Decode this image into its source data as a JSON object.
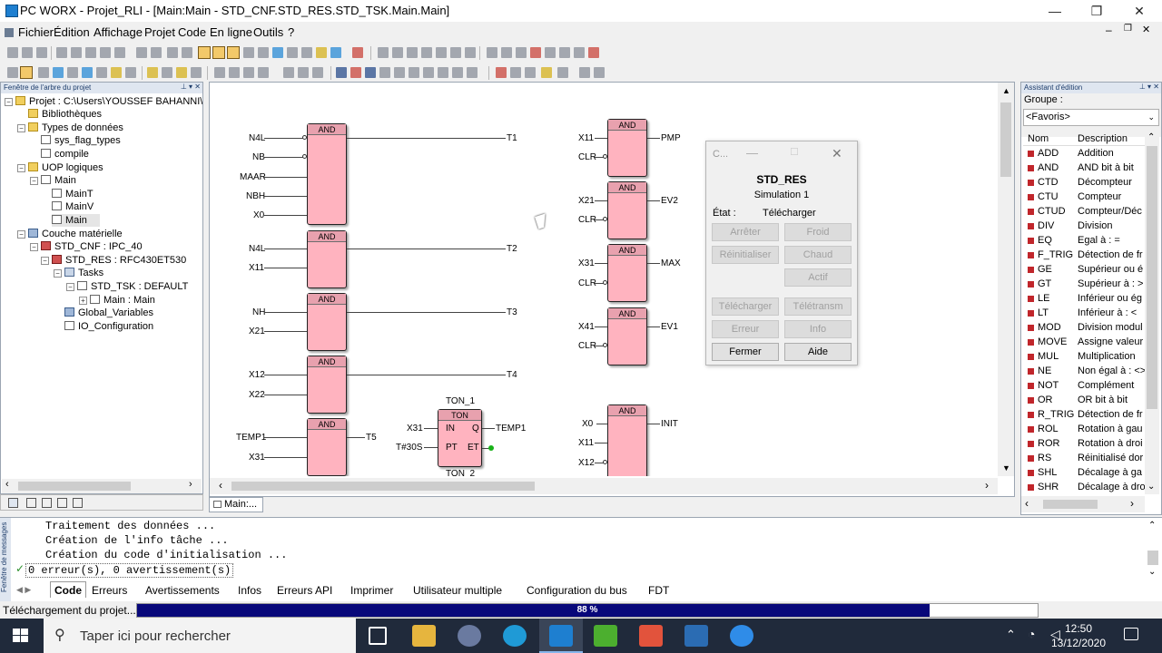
{
  "window": {
    "title": "PC WORX - Projet_RLI - [Main:Main - STD_CNF.STD_RES.STD_TSK.Main.Main]",
    "minimize": "—",
    "maximize": "❐",
    "close": "✕"
  },
  "menu": [
    "Fichier",
    "Édition",
    "Affichage",
    "Projet",
    "Code",
    "En ligne",
    "Outils",
    "?"
  ],
  "tree": {
    "title": "Fenêtre de l'arbre du projet",
    "items": [
      "Projet : C:\\Users\\YOUSSEF BAHANNI\\D",
      "Bibliothèques",
      "Types de données",
      "sys_flag_types",
      "compile",
      "UOP logiques",
      "Main",
      "MainT",
      "MainV",
      "Main",
      "Couche matérielle",
      "STD_CNF : IPC_40",
      "STD_RES : RFC430ET530",
      "Tasks",
      "STD_TSK : DEFAULT",
      "Main : Main",
      "Global_Variables",
      "IO_Configuration"
    ]
  },
  "editor": {
    "tab": "Main:...",
    "blocks": {
      "and_type": "AND",
      "ton_type": "TON",
      "ton_instance": "TON_1",
      "ton_bottom": "TON_2",
      "b1_in": [
        "N4L",
        "NB",
        "MAAR",
        "NBH",
        "X0"
      ],
      "b1_out": "T1",
      "b2_in": [
        "N4L",
        "X11"
      ],
      "b2_out": "T2",
      "b3_in": [
        "NH",
        "X21"
      ],
      "b3_out": "T3",
      "b4_in": [
        "X12",
        "X22"
      ],
      "b4_out": "T4",
      "b5_in": [
        "TEMP1",
        "X31"
      ],
      "b5_out": "T5",
      "ton_in1": "X31",
      "ton_in2": "T#30S",
      "ton_pin_in": "IN",
      "ton_pin_pt": "PT",
      "ton_pin_q": "Q",
      "ton_pin_et": "ET",
      "ton_out": "TEMP1",
      "r1_in": [
        "X11",
        "CLR"
      ],
      "r1_out": "PMP",
      "r2_in": [
        "X21",
        "CLR"
      ],
      "r2_out": "EV2",
      "r3_in": [
        "X31",
        "CLR"
      ],
      "r3_out": "MAX",
      "r4_in": [
        "X41",
        "CLR"
      ],
      "r4_out": "EV1",
      "r5_in": [
        "X0",
        "X11",
        "X12"
      ],
      "r5_out": "INIT"
    }
  },
  "dialog": {
    "caption": "C...",
    "title": "STD_RES",
    "subtitle": "Simulation 1",
    "state_label": "État :",
    "state_value": "Télécharger",
    "buttons": {
      "stop": "Arrêter",
      "cold": "Froid",
      "reset": "Réinitialiser",
      "warm": "Chaud",
      "active": "Actif",
      "download": "Télécharger",
      "transfer": "Télétransm",
      "error": "Erreur",
      "info": "Info",
      "close": "Fermer",
      "help": "Aide"
    }
  },
  "library": {
    "title": "Assistant d'édition",
    "group_label": "Groupe :",
    "group_value": "<Favoris>",
    "col_name": "Nom",
    "col_desc": "Description",
    "rows": [
      {
        "name": "ADD",
        "desc": "Addition"
      },
      {
        "name": "AND",
        "desc": "AND bit à bit"
      },
      {
        "name": "CTD",
        "desc": "Décompteur"
      },
      {
        "name": "CTU",
        "desc": "Compteur"
      },
      {
        "name": "CTUD",
        "desc": "Compteur/Déc"
      },
      {
        "name": "DIV",
        "desc": "Division"
      },
      {
        "name": "EQ",
        "desc": "Egal à : ="
      },
      {
        "name": "F_TRIG",
        "desc": "Détection de fr"
      },
      {
        "name": "GE",
        "desc": "Supérieur ou é"
      },
      {
        "name": "GT",
        "desc": "Supérieur à : >"
      },
      {
        "name": "LE",
        "desc": "Inférieur ou ég"
      },
      {
        "name": "LT",
        "desc": "Inférieur à : <"
      },
      {
        "name": "MOD",
        "desc": "Division modul"
      },
      {
        "name": "MOVE",
        "desc": "Assigne valeur"
      },
      {
        "name": "MUL",
        "desc": "Multiplication"
      },
      {
        "name": "NE",
        "desc": "Non égal à : <>"
      },
      {
        "name": "NOT",
        "desc": "Complément"
      },
      {
        "name": "OR",
        "desc": "OR bit à bit"
      },
      {
        "name": "R_TRIG",
        "desc": "Détection de fr"
      },
      {
        "name": "ROL",
        "desc": "Rotation à gau"
      },
      {
        "name": "ROR",
        "desc": "Rotation à droi"
      },
      {
        "name": "RS",
        "desc": "Réinitialisé dor"
      },
      {
        "name": "SHL",
        "desc": "Décalage à ga"
      },
      {
        "name": "SHR",
        "desc": "Décalage à dro"
      }
    ]
  },
  "output": {
    "side_label": "Fenêtre de messages",
    "lines": [
      "Traitement des données ...",
      "Création de l'info tâche ...",
      "Création du code d'initialisation ...",
      "0 erreur(s), 0 avertissement(s)"
    ],
    "tabs": [
      "Code",
      "Erreurs",
      "Avertissements",
      "Infos",
      "Erreurs API",
      "Imprimer",
      "Utilisateur multiple",
      "Configuration du bus",
      "FDT"
    ]
  },
  "status": {
    "text": "Téléchargement du projet...",
    "progress_label": "88 %",
    "progress": 0.88
  },
  "taskbar": {
    "search_placeholder": "Taper ici pour rechercher",
    "time": "12:50",
    "date": "13/12/2020"
  }
}
